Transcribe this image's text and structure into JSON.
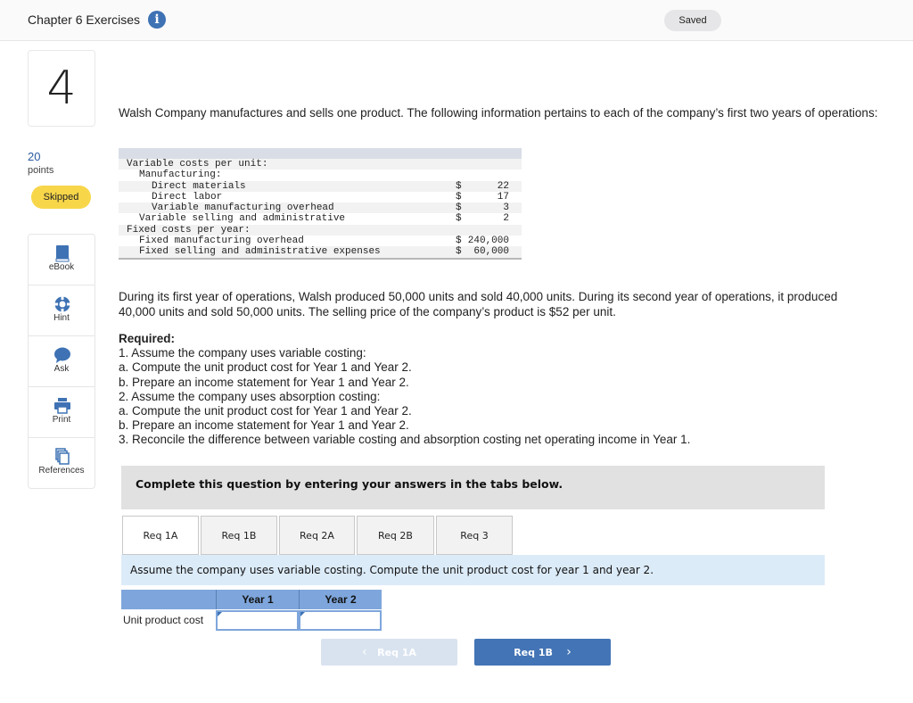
{
  "header": {
    "title": "Chapter 6 Exercises",
    "info_icon": "info-icon",
    "status": "Saved"
  },
  "question": {
    "number": "4",
    "points_value": "20",
    "points_label": "points",
    "status_badge": "Skipped"
  },
  "tools": [
    {
      "label": "eBook",
      "icon": "book-icon"
    },
    {
      "label": "Hint",
      "icon": "lifebuoy-icon"
    },
    {
      "label": "Ask",
      "icon": "speech-bubble-icon"
    },
    {
      "label": "Print",
      "icon": "printer-icon"
    },
    {
      "label": "References",
      "icon": "documents-icon"
    }
  ],
  "content": {
    "intro": "Walsh Company manufactures and sells one product. The following information pertains to each of the company’s first two years of operations:",
    "cost_table": [
      {
        "label": "Variable costs per unit:",
        "indent": 0,
        "currency": "",
        "value": ""
      },
      {
        "label": "Manufacturing:",
        "indent": 1,
        "currency": "",
        "value": ""
      },
      {
        "label": "Direct materials",
        "indent": 2,
        "currency": "$",
        "value": "22"
      },
      {
        "label": "Direct labor",
        "indent": 2,
        "currency": "$",
        "value": "17"
      },
      {
        "label": "Variable manufacturing overhead",
        "indent": 2,
        "currency": "$",
        "value": "3"
      },
      {
        "label": "Variable selling and administrative",
        "indent": 1,
        "currency": "$",
        "value": "2"
      },
      {
        "label": "Fixed costs per year:",
        "indent": 0,
        "currency": "",
        "value": ""
      },
      {
        "label": "Fixed manufacturing overhead",
        "indent": 1,
        "currency": "$",
        "value": "240,000"
      },
      {
        "label": "Fixed selling and administrative expenses",
        "indent": 1,
        "currency": "$",
        "value": " 60,000"
      }
    ],
    "paragraph2": "During its first year of operations, Walsh produced 50,000 units and sold 40,000 units. During its second year of operations, it produced 40,000 units and sold 50,000 units. The selling price of the company’s product is $52 per unit.",
    "required_title": "Required:",
    "required_items": [
      "1. Assume the company uses variable costing:",
      "a. Compute the unit product cost for Year 1 and Year 2.",
      "b. Prepare an income statement for Year 1 and Year 2.",
      "2. Assume the company uses absorption costing:",
      "a. Compute the unit product cost for Year 1 and Year 2.",
      "b. Prepare an income statement for Year 1 and Year 2.",
      "3. Reconcile the difference between variable costing and absorption costing net operating income in Year 1."
    ],
    "instruction": "Complete this question by entering your answers in the tabs below."
  },
  "tabs": [
    {
      "label": "Req 1A",
      "active": true
    },
    {
      "label": "Req 1B",
      "active": false
    },
    {
      "label": "Req 2A",
      "active": false
    },
    {
      "label": "Req 2B",
      "active": false
    },
    {
      "label": "Req 3",
      "active": false
    }
  ],
  "answer": {
    "prompt": "Assume the company uses variable costing. Compute the unit product cost for year 1 and year 2.",
    "columns": [
      "Year 1",
      "Year 2"
    ],
    "row_label": "Unit product cost",
    "values": [
      "",
      ""
    ]
  },
  "navigation": {
    "prev_label": "Req 1A",
    "next_label": "Req 1B",
    "prev_icon": "‹",
    "next_icon": "›"
  },
  "colors": {
    "accent_blue": "#4374b5",
    "skipped_yellow": "#f7d64a",
    "table_header_blue": "#7ea6dc",
    "prompt_bg": "#dcebf8"
  }
}
